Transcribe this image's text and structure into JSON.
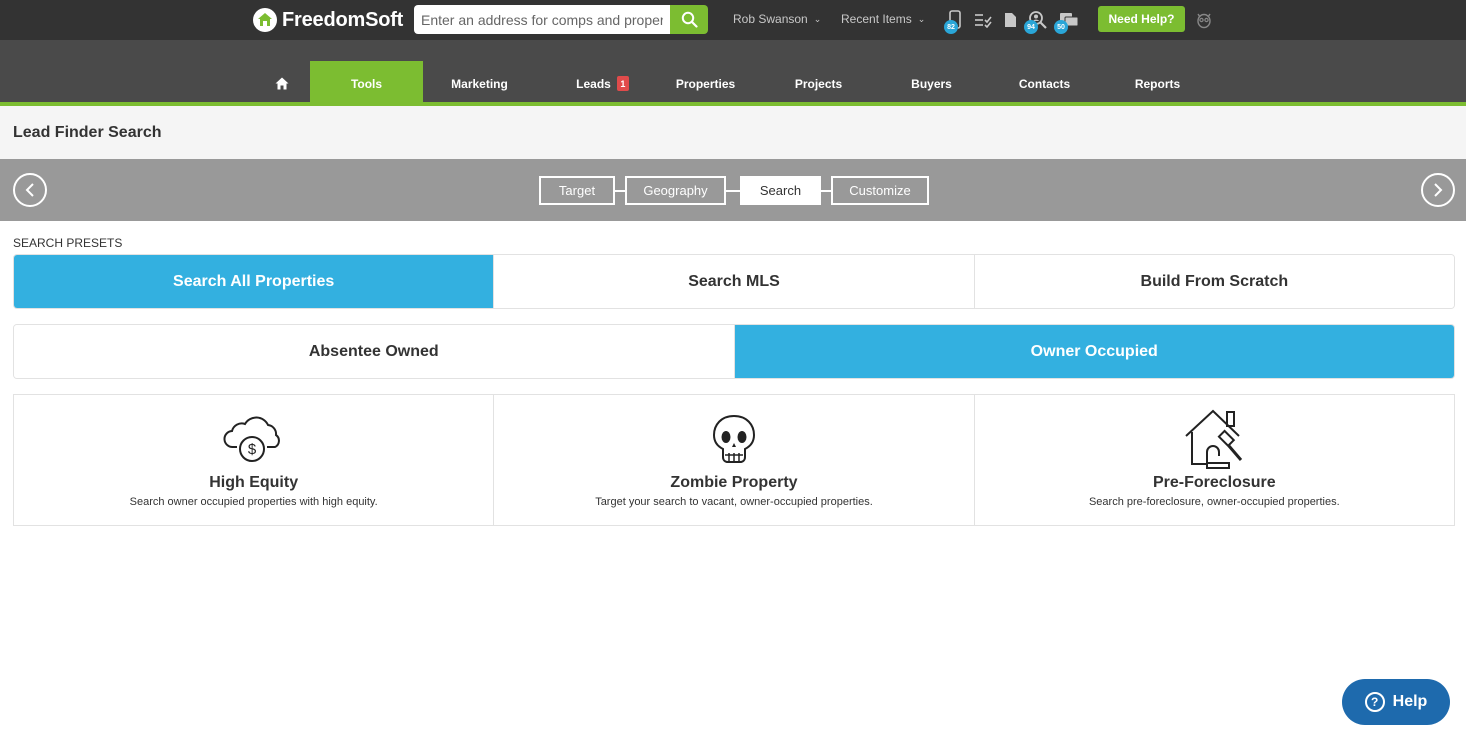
{
  "brand": {
    "name": "FreedomSoft"
  },
  "top": {
    "search_placeholder": "Enter an address for comps and property info",
    "user_menu": "Rob Swanson",
    "recent_items": "Recent Items",
    "badges": {
      "phone": "82",
      "leads_search": "94",
      "chat": "50"
    },
    "need_help": "Need Help?"
  },
  "nav": {
    "home_icon": "home-icon",
    "items": [
      {
        "label": "Tools",
        "active": true
      },
      {
        "label": "Marketing"
      },
      {
        "label": "Leads",
        "badge": "1"
      },
      {
        "label": "Properties"
      },
      {
        "label": "Projects"
      },
      {
        "label": "Buyers"
      },
      {
        "label": "Contacts"
      },
      {
        "label": "Reports"
      }
    ]
  },
  "page": {
    "title": "Lead Finder Search"
  },
  "wizard": {
    "steps": [
      "Target",
      "Geography",
      "Search",
      "Customize"
    ],
    "current": "Search"
  },
  "presets": {
    "label": "SEARCH PRESETS",
    "row1": [
      "Search All Properties",
      "Search MLS",
      "Build From Scratch"
    ],
    "row1_selected": "Search All Properties",
    "row2": [
      "Absentee Owned",
      "Owner Occupied"
    ],
    "row2_selected": "Owner Occupied"
  },
  "cards": [
    {
      "icon": "cloud-dollar-icon",
      "title": "High Equity",
      "desc": "Search owner occupied properties with high equity."
    },
    {
      "icon": "skull-icon",
      "title": "Zombie Property",
      "desc": "Target your search to vacant, owner-occupied properties."
    },
    {
      "icon": "house-gavel-icon",
      "title": "Pre-Foreclosure",
      "desc": "Search pre-foreclosure, owner-occupied properties."
    }
  ],
  "help_float": {
    "label": "Help"
  },
  "colors": {
    "accent_green": "#7cbd31",
    "accent_blue": "#33b0e0",
    "topbar": "#333333",
    "nav": "#4a4a4a",
    "badge_red": "#e04b4b",
    "help_blue": "#1e6aad"
  }
}
